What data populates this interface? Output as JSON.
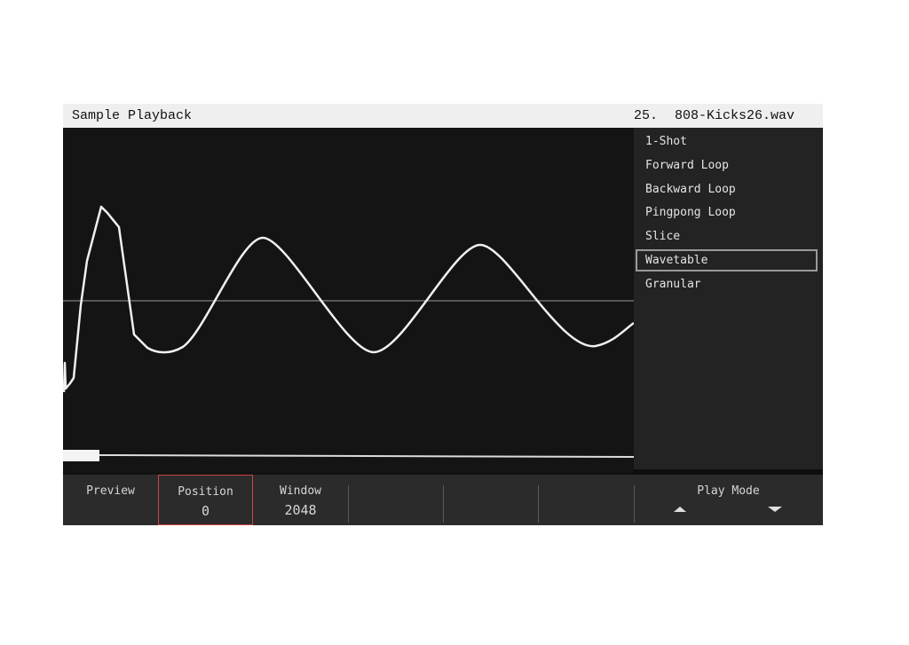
{
  "header": {
    "title": "Sample Playback",
    "sample_index": "25.",
    "sample_name": "808-Kicks26.wav"
  },
  "play_modes": {
    "items": [
      "1-Shot",
      "Forward Loop",
      "Backward Loop",
      "Pingpong Loop",
      "Slice",
      "Wavetable",
      "Granular"
    ],
    "selected": "Wavetable"
  },
  "bottom_bar": {
    "preview_label": "Preview",
    "position_label": "Position",
    "position_value": "0",
    "window_label": "Window",
    "window_value": "2048",
    "play_mode_label": "Play Mode"
  },
  "icons": {
    "up_arrow": "triangle-up-icon",
    "down_arrow": "triangle-down-icon"
  },
  "colors": {
    "selection_border": "#c44444",
    "list_selection_border": "#9a9a9a",
    "waveform": "#f0f0f0"
  }
}
